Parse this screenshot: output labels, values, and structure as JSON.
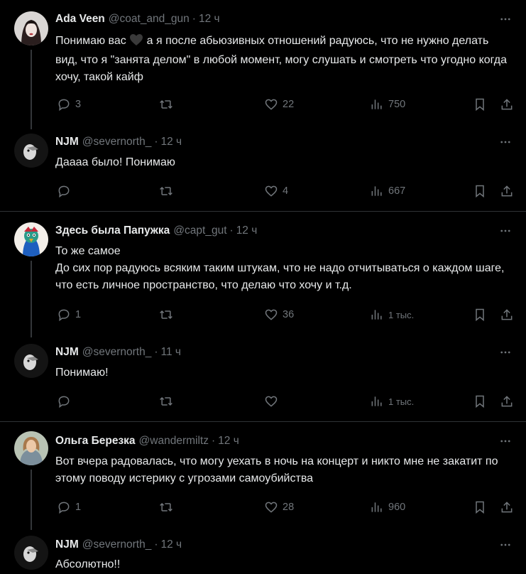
{
  "tweets": [
    {
      "name": "Ada Veen",
      "handle": "@coat_and_gun",
      "time": "12 ч",
      "text_before_heart": "Понимаю вас ",
      "text_after_heart": " а я после абьюзивных отношений радуюсь, что не нужно делать вид, что я \"занята делом\" в любой момент, могу слушать и смотреть что угодно когда хочу, такой кайф",
      "replies": "3",
      "retweets": "",
      "likes": "22",
      "views": "750"
    },
    {
      "name": "NJM",
      "handle": "@severnorth_",
      "time": "12 ч",
      "text": "Даааа было! Понимаю",
      "replies": "",
      "retweets": "",
      "likes": "4",
      "views": "667"
    },
    {
      "name": "Здесь была Папужка",
      "handle": "@capt_gut",
      "time": "12 ч",
      "text": "То же самое\nДо сих пор радуюсь всяким таким штукам, что не надо отчитываться о каждом шаге, что есть личное пространство, что делаю что хочу и т.д.",
      "replies": "1",
      "retweets": "",
      "likes": "36",
      "views": "1 тыс."
    },
    {
      "name": "NJM",
      "handle": "@severnorth_",
      "time": "11 ч",
      "text": "Понимаю!",
      "replies": "",
      "retweets": "",
      "likes": "",
      "views": "1 тыс."
    },
    {
      "name": "Ольга Березка",
      "handle": "@wandermiltz",
      "time": "12 ч",
      "text": "Вот вчера радовалась, что могу уехать в ночь на концерт и никто мне не закатит по этому поводу истерику с угрозами самоубийства",
      "replies": "1",
      "retweets": "",
      "likes": "28",
      "views": "960"
    },
    {
      "name": "NJM",
      "handle": "@severnorth_",
      "time": "12 ч",
      "text": "Абсолютно!!"
    }
  ],
  "colors": {
    "background": "#000000",
    "text": "#e7e9ea",
    "muted": "#71767b",
    "divider": "#2f3336"
  },
  "icons": [
    "reply-icon",
    "retweet-icon",
    "like-icon",
    "views-icon",
    "bookmark-icon",
    "share-icon",
    "more-icon",
    "heart-emoji-icon"
  ]
}
